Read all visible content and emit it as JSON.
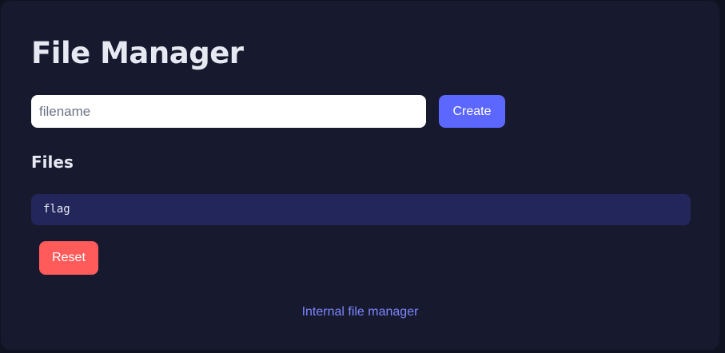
{
  "header": {
    "title": "File Manager"
  },
  "create_form": {
    "placeholder": "filename",
    "value": "",
    "create_label": "Create"
  },
  "files": {
    "heading": "Files",
    "items": [
      {
        "name": "flag"
      }
    ]
  },
  "actions": {
    "reset_label": "Reset"
  },
  "footer": {
    "link_text": "Internal file manager"
  },
  "colors": {
    "background": "#171a2e",
    "accent": "#5c67ff",
    "danger": "#ff5b5b",
    "file_row": "#23265a",
    "link": "#7d86ff"
  }
}
